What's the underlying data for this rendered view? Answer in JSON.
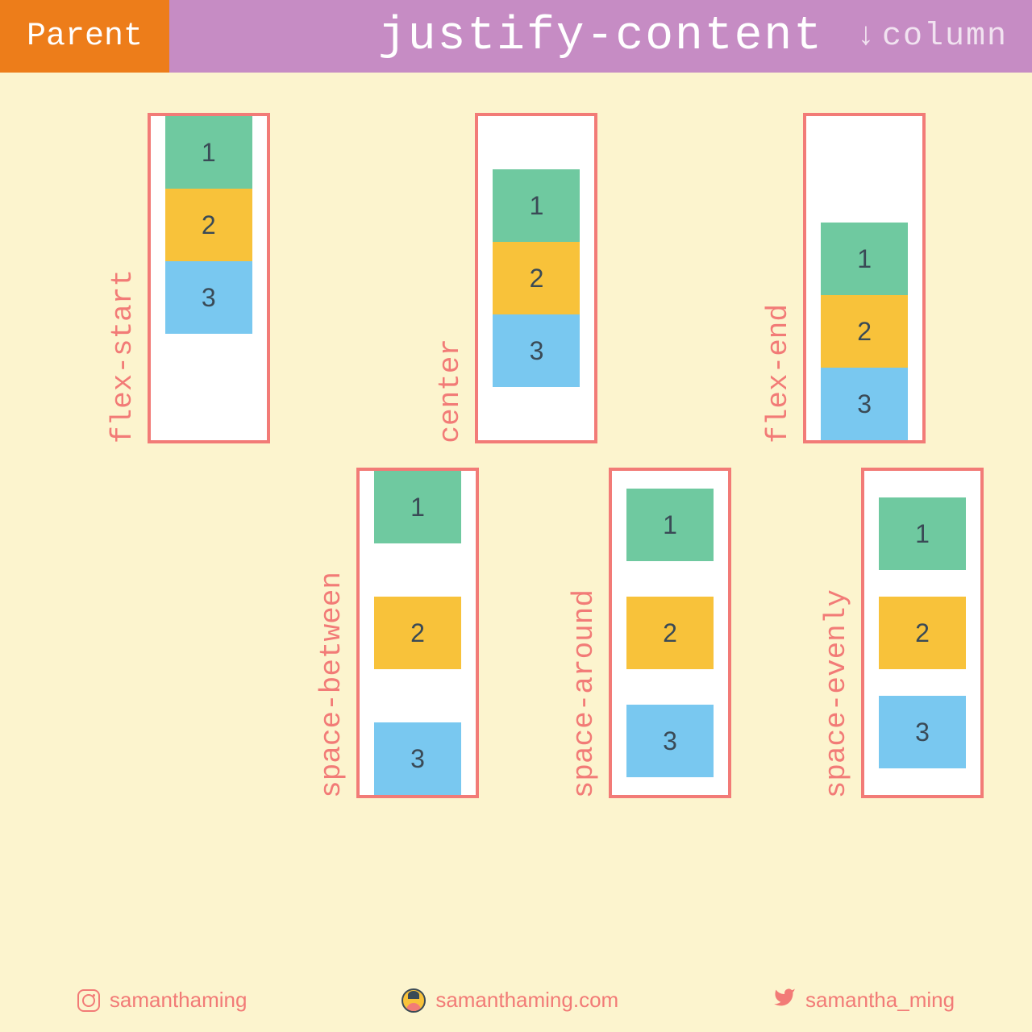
{
  "header": {
    "parent_label": "Parent",
    "title": "justify-content",
    "direction_label": "column",
    "direction_arrow": "↓"
  },
  "demos": {
    "flex_start": {
      "label": "flex-start",
      "items": [
        "1",
        "2",
        "3"
      ]
    },
    "center": {
      "label": "center",
      "items": [
        "1",
        "2",
        "3"
      ]
    },
    "flex_end": {
      "label": "flex-end",
      "items": [
        "1",
        "2",
        "3"
      ]
    },
    "space_between": {
      "label": "space-between",
      "items": [
        "1",
        "2",
        "3"
      ]
    },
    "space_around": {
      "label": "space-around",
      "items": [
        "1",
        "2",
        "3"
      ]
    },
    "space_evenly": {
      "label": "space-evenly",
      "items": [
        "1",
        "2",
        "3"
      ]
    }
  },
  "footer": {
    "instagram": "samanthaming",
    "website": "samanthaming.com",
    "twitter": "samantha_ming"
  },
  "colors": {
    "bg": "#fcf4ce",
    "orange": "#ed7d1a",
    "purple": "#c68cc4",
    "salmon": "#f27b77",
    "green": "#6fc9a0",
    "yellow": "#f8c23a",
    "blue": "#79c8f0"
  }
}
